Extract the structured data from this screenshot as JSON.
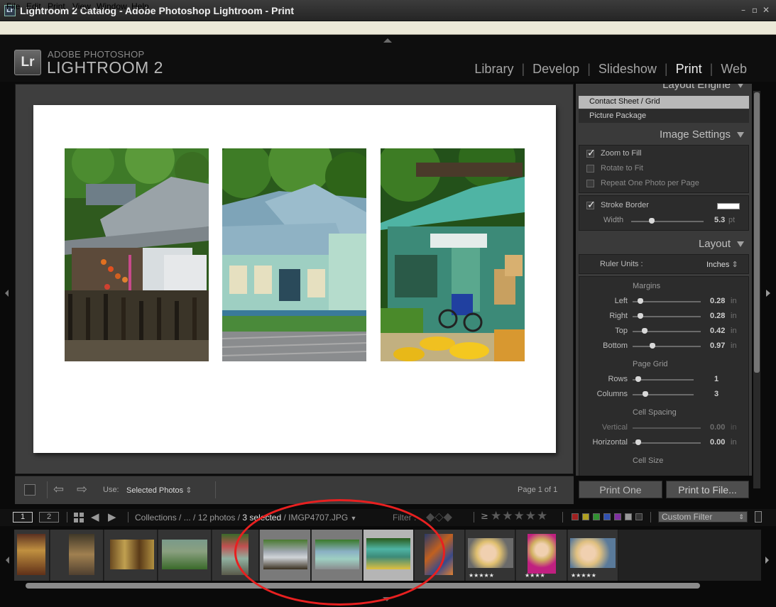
{
  "window": {
    "title": "Lightroom 2 Catalog - Adobe Photoshop Lightroom - Print",
    "icon_text": "Lr"
  },
  "menu": [
    "File",
    "Edit",
    "Print",
    "View",
    "Window",
    "Help"
  ],
  "brand": {
    "badge": "Lr",
    "line1": "ADOBE PHOTOSHOP",
    "line2": "LIGHTROOM 2"
  },
  "modules": {
    "items": [
      "Library",
      "Develop",
      "Slideshow",
      "Print",
      "Web"
    ],
    "active": "Print"
  },
  "right_panel": {
    "layout_engine": {
      "title": "Layout Engine",
      "options": [
        "Contact Sheet / Grid",
        "Picture Package"
      ],
      "selected": "Contact Sheet / Grid"
    },
    "image_settings": {
      "title": "Image Settings",
      "zoom_to_fill": "Zoom to Fill",
      "rotate_to_fit": "Rotate to Fit",
      "repeat_one": "Repeat One Photo per Page",
      "stroke_border": "Stroke Border",
      "width_label": "Width",
      "width_value": "5.3",
      "width_unit": "pt"
    },
    "layout": {
      "title": "Layout",
      "ruler_label": "Ruler Units :",
      "ruler_value": "Inches",
      "margins_title": "Margins",
      "margins": [
        {
          "label": "Left",
          "value": "0.28",
          "unit": "in"
        },
        {
          "label": "Right",
          "value": "0.28",
          "unit": "in"
        },
        {
          "label": "Top",
          "value": "0.42",
          "unit": "in"
        },
        {
          "label": "Bottom",
          "value": "0.97",
          "unit": "in"
        }
      ],
      "page_grid_title": "Page Grid",
      "grid": [
        {
          "label": "Rows",
          "value": "1"
        },
        {
          "label": "Columns",
          "value": "3"
        }
      ],
      "cell_spacing_title": "Cell Spacing",
      "spacing": [
        {
          "label": "Vertical",
          "value": "0.00",
          "unit": "in"
        },
        {
          "label": "Horizontal",
          "value": "0.00",
          "unit": "in"
        }
      ],
      "cell_size_title": "Cell Size"
    },
    "print_one": "Print One",
    "print_to_file": "Print to File..."
  },
  "toolbar": {
    "use_label": "Use:",
    "use_value": "Selected Photos",
    "page_info": "Page 1 of 1"
  },
  "filmstrip_bar": {
    "screen1": "1",
    "screen2": "2",
    "path": "Collections / ... / 12 photos /",
    "selected": "3 selected",
    "filename": "/ IMGP4707.JPG",
    "filter_label": "Filter :",
    "rating_op": "≥",
    "stars": "★★★★★",
    "custom_filter": "Custom Filter"
  },
  "thumbs": [
    {
      "stars": ""
    },
    {
      "stars": ""
    },
    {
      "stars": ""
    },
    {
      "stars": ""
    },
    {
      "stars": ""
    },
    {
      "stars": ""
    },
    {
      "stars": ""
    },
    {
      "stars": ""
    },
    {
      "stars": ""
    },
    {
      "stars": "★★★★★"
    },
    {
      "stars": "★★★★"
    },
    {
      "stars": "★★★★★"
    }
  ],
  "colors": {
    "annotation": "#e82020",
    "panel": "#3a3a3a",
    "background": "#0a0a0a"
  }
}
